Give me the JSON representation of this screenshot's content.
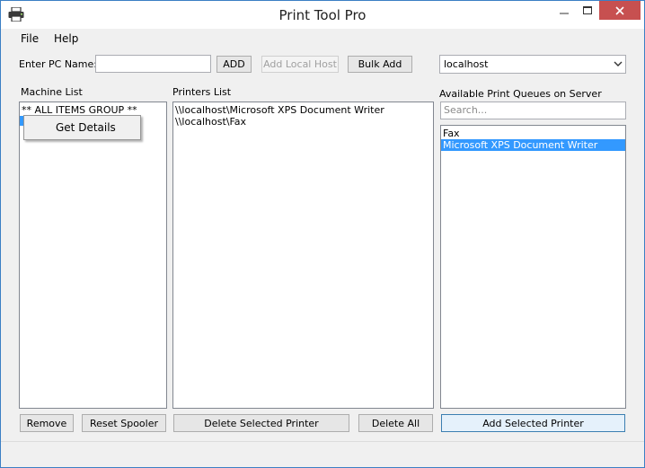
{
  "window": {
    "title": "Print Tool Pro"
  },
  "menu": {
    "file": "File",
    "help": "Help"
  },
  "toolbar": {
    "pc_name_label": "Enter PC Name:",
    "pc_name_value": "",
    "add_label": "ADD",
    "add_local_label": "Add Local Host",
    "bulk_add_label": "Bulk Add",
    "host_selected": "localhost"
  },
  "machine_list": {
    "heading": "Machine List",
    "items": [
      "** ALL ITEMS GROUP **"
    ]
  },
  "context_menu": {
    "item": "Get Details"
  },
  "printers_list": {
    "heading": "Printers List",
    "items": [
      "\\\\localhost\\Microsoft XPS Document Writer",
      "\\\\localhost\\Fax"
    ]
  },
  "queues": {
    "heading": "Available Print Queues on Server",
    "search_placeholder": "Search...",
    "items": [
      "Fax",
      "Microsoft XPS Document Writer"
    ],
    "selected_index": 1
  },
  "buttons": {
    "remove": "Remove",
    "reset_spooler": "Reset Spooler",
    "delete_selected": "Delete Selected Printer",
    "delete_all": "Delete All",
    "add_selected": "Add Selected Printer"
  },
  "colors": {
    "accent": "#3399ff",
    "close": "#c75050",
    "border": "#3b7fc4"
  },
  "icons": {
    "app": "printer-icon",
    "minimize": "minimize-icon",
    "maximize": "maximize-icon",
    "close": "close-icon",
    "dropdown": "chevron-down-icon"
  }
}
